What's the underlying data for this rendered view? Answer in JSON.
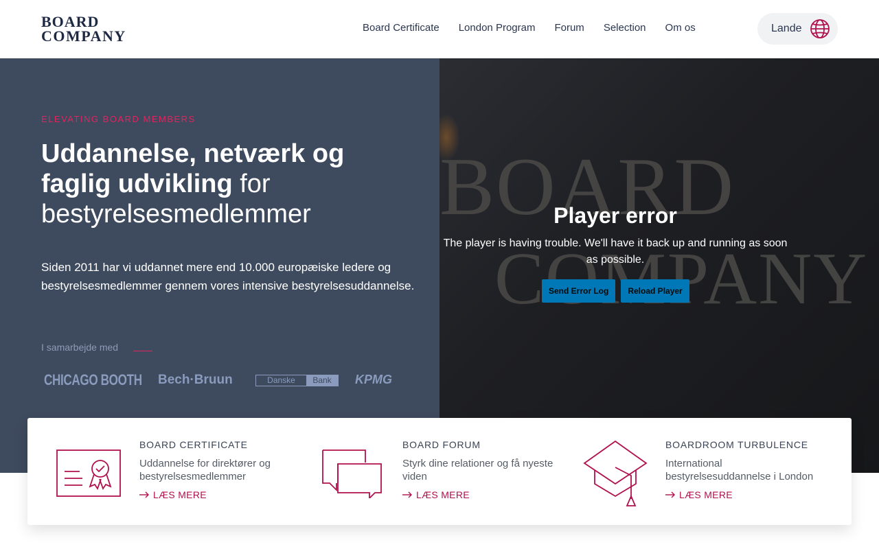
{
  "header": {
    "logo_line1": "BOARD",
    "logo_line2": "COMPANY",
    "nav": [
      "Board Certificate",
      "London Program",
      "Forum",
      "Selection",
      "Om os"
    ],
    "lande_label": "Lande"
  },
  "hero": {
    "eyebrow": "ELEVATING BOARD MEMBERS",
    "headline_bold": "Uddannelse, netværk og faglig udvikling",
    "headline_rest": " for bestyrelsesmedlemmer",
    "lead": "Siden 2011 har vi uddannet mere end 10.000 europæiske ledere og bestyrelsesmedlemmer gennem vores intensive bestyrelsesuddannelse.",
    "partners_label": "I samarbejde med",
    "partners": {
      "chicago": "CHICAGO BOOTH",
      "bech": "Bech·Bruun",
      "danske_a": "Danske",
      "danske_b": "Bank",
      "kpmg": "KPMG"
    }
  },
  "video": {
    "bg_line1": "BOARD",
    "bg_line2": "COMPANY",
    "error_title": "Player error",
    "error_message": "The player is having trouble. We'll have it back up and running as soon as possible.",
    "send_log_label": "Send Error Log",
    "reload_label": "Reload Player"
  },
  "cards": [
    {
      "title": "BOARD CERTIFICATE",
      "desc": "Uddannelse for direktører og bestyrelsesmedlemmer",
      "link": "LÆS MERE",
      "icon": "certificate-icon"
    },
    {
      "title": "BOARD FORUM",
      "desc": "Styrk dine relationer og få nyeste viden",
      "link": "LÆS MERE",
      "icon": "chat-bubbles-icon"
    },
    {
      "title": "BOARDROOM TURBULENCE",
      "desc": "International bestyrelsesuddannelse i London",
      "link": "LÆS MERE",
      "icon": "graduation-cap-icon"
    }
  ],
  "colors": {
    "accent": "#e0245e",
    "link": "#b0104c",
    "hero_bg": "#3e4a5d",
    "navy": "#1e2a44",
    "player_button": "#0077b6"
  }
}
